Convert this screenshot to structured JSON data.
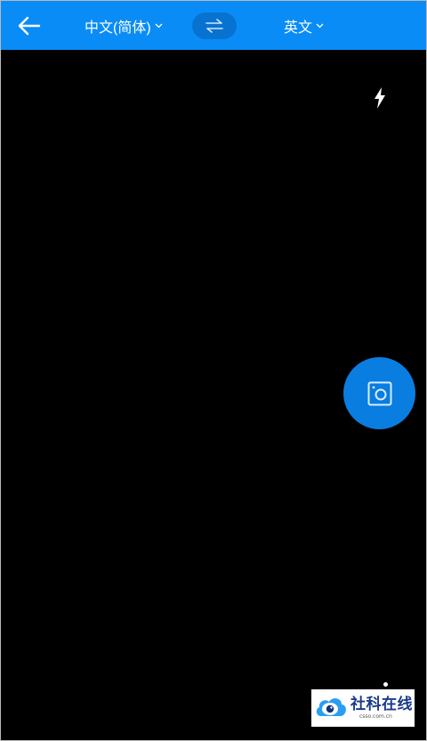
{
  "header": {
    "back_icon": "arrow-left-icon",
    "source_language": "中文(简体)",
    "target_language": "英文",
    "swap_icon": "swap-arrows-icon",
    "chevron_icon": "chevron-down-icon"
  },
  "camera": {
    "flash_icon": "flash-icon",
    "capture_icon": "camera-capture-icon"
  },
  "watermark": {
    "title": "社科在线",
    "subtitle": "csso.com.cn"
  },
  "colors": {
    "header_bg": "#0a8cf7",
    "swap_bg": "#0872d1",
    "capture_bg": "#0a7de0",
    "viewfinder_bg": "#000000"
  }
}
